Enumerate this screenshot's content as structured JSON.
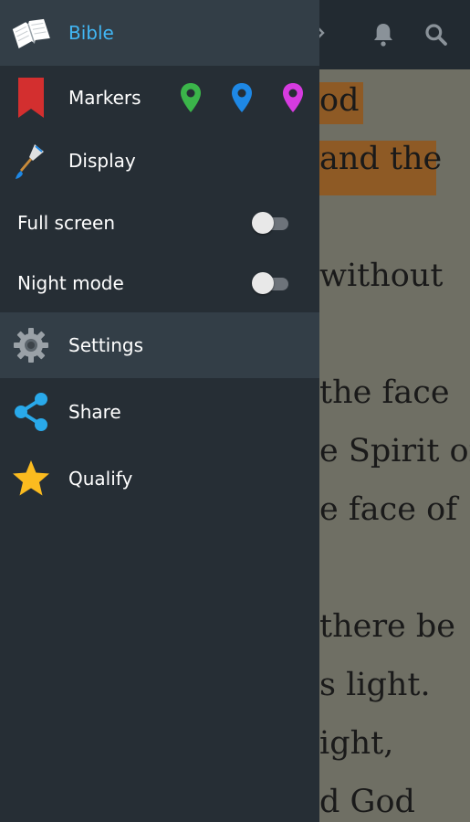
{
  "drawer": {
    "items": [
      {
        "label": "Bible",
        "icon": "book-icon",
        "selected": true
      },
      {
        "label": "Markers",
        "icon": "bookmark-icon"
      },
      {
        "label": "Display",
        "icon": "paintbrush-icon"
      },
      {
        "label": "Full screen",
        "toggle": false
      },
      {
        "label": "Night mode",
        "toggle": false
      },
      {
        "label": "Settings",
        "icon": "gear-icon",
        "selected": true
      },
      {
        "label": "Share",
        "icon": "share-icon"
      },
      {
        "label": "Qualify",
        "icon": "star-icon"
      }
    ],
    "marker_colors": [
      "#3bb54a",
      "#1e88e5",
      "#d63be0"
    ]
  },
  "page": {
    "lines": [
      "od",
      "and the",
      "",
      " without",
      "",
      "the face",
      "e Spirit of",
      "e face of",
      "",
      "there be",
      "s light.",
      "ight,",
      "d God"
    ]
  }
}
